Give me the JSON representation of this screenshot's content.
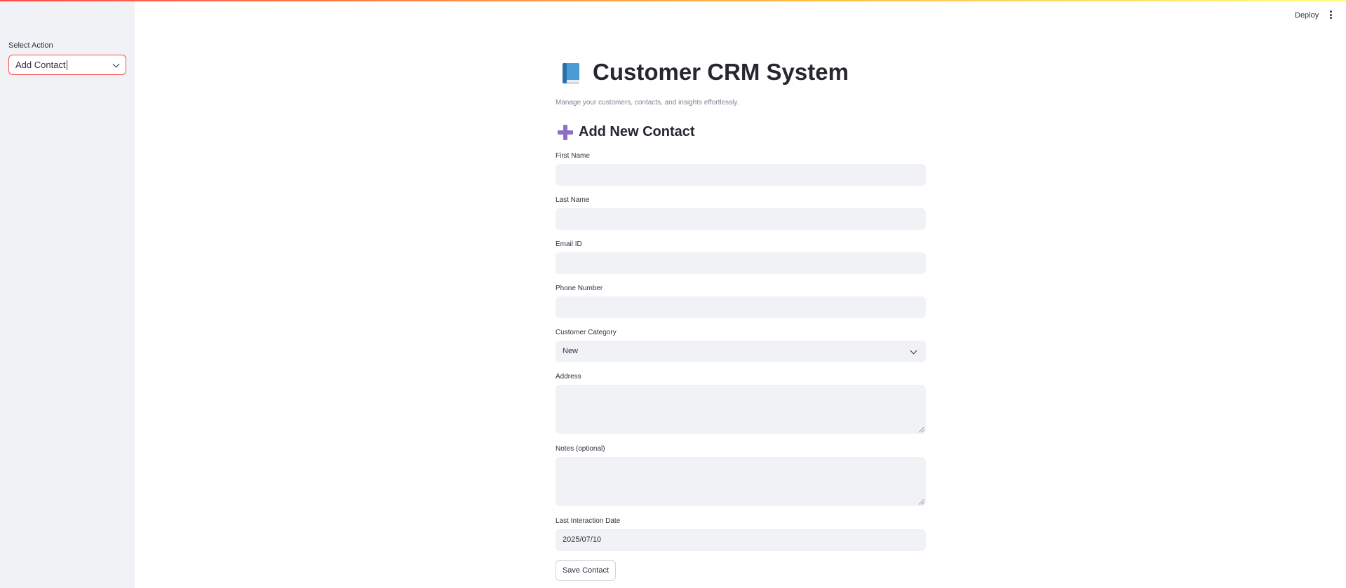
{
  "header": {
    "deploy_label": "Deploy"
  },
  "sidebar": {
    "select_label": "Select Action",
    "select_value": "Add Contact"
  },
  "main": {
    "title": "Customer CRM System",
    "subtitle": "Manage your customers, contacts, and insights effortlessly.",
    "section_title": "Add New Contact",
    "fields": {
      "first_name": {
        "label": "First Name",
        "value": ""
      },
      "last_name": {
        "label": "Last Name",
        "value": ""
      },
      "email": {
        "label": "Email ID",
        "value": ""
      },
      "phone": {
        "label": "Phone Number",
        "value": ""
      },
      "category": {
        "label": "Customer Category",
        "value": "New"
      },
      "address": {
        "label": "Address",
        "value": ""
      },
      "notes": {
        "label": "Notes (optional)",
        "value": ""
      },
      "last_interaction": {
        "label": "Last Interaction Date",
        "value": "2025/07/10"
      }
    },
    "save_label": "Save Contact"
  },
  "icons": {
    "title_icon": "blue-book-icon",
    "section_icon": "plus-icon",
    "select_icon": "chevron-down-icon",
    "menu_icon": "kebab-menu-icon"
  },
  "colors": {
    "accent": "#ff4b4b",
    "sidebar_bg": "#f0f2f6",
    "input_bg": "#f0f2f6",
    "book": "#4b9bd6",
    "plus": "#8e6fc4"
  }
}
